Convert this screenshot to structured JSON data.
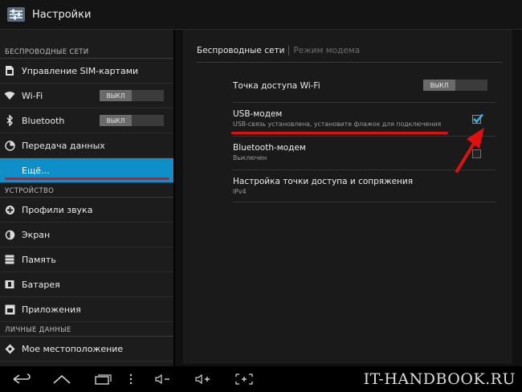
{
  "app": {
    "title": "Настройки"
  },
  "sidebar": {
    "sections": [
      {
        "header": "БЕСПРОВОДНЫЕ СЕТИ"
      },
      {
        "header": "УСТРОЙСТВО"
      },
      {
        "header": "ЛИЧНЫЕ ДАННЫЕ"
      }
    ],
    "items": [
      {
        "label": "Управление SIM-картами",
        "icon": "sim-icon"
      },
      {
        "label": "Wi-Fi",
        "icon": "wifi-icon",
        "toggle": "ВЫКЛ"
      },
      {
        "label": "Bluetooth",
        "icon": "bluetooth-icon",
        "toggle": "ВЫКЛ"
      },
      {
        "label": "Передача данных",
        "icon": "data-usage-icon"
      },
      {
        "label": "Ещё...",
        "selected": true
      },
      {
        "label": "Профили звука",
        "icon": "sound-icon"
      },
      {
        "label": "Экран",
        "icon": "display-icon"
      },
      {
        "label": "Память",
        "icon": "storage-icon"
      },
      {
        "label": "Батарея",
        "icon": "battery-icon"
      },
      {
        "label": "Приложения",
        "icon": "apps-icon"
      },
      {
        "label": "Мое местоположение",
        "icon": "location-icon"
      }
    ]
  },
  "main": {
    "breadcrumb": {
      "active": "Беспроводные сети",
      "inactive": "Режим модема"
    },
    "prefs": [
      {
        "title": "Точка доступа Wi-Fi",
        "toggle": "ВЫКЛ"
      },
      {
        "title": "USB-модем",
        "summary": "USB-связь установлена, установите флажок для подключения",
        "checked": true
      },
      {
        "title": "Bluetooth-модем",
        "summary": "Выключен",
        "checked": false
      },
      {
        "title": "Настройка точки доступа и сопряжения",
        "summary": "IPv4"
      }
    ]
  },
  "watermark": "IT-HANDBOOK.RU",
  "colors": {
    "accent": "#0f8fc7",
    "highlight": "#e01010",
    "check": "#33b5e5"
  }
}
